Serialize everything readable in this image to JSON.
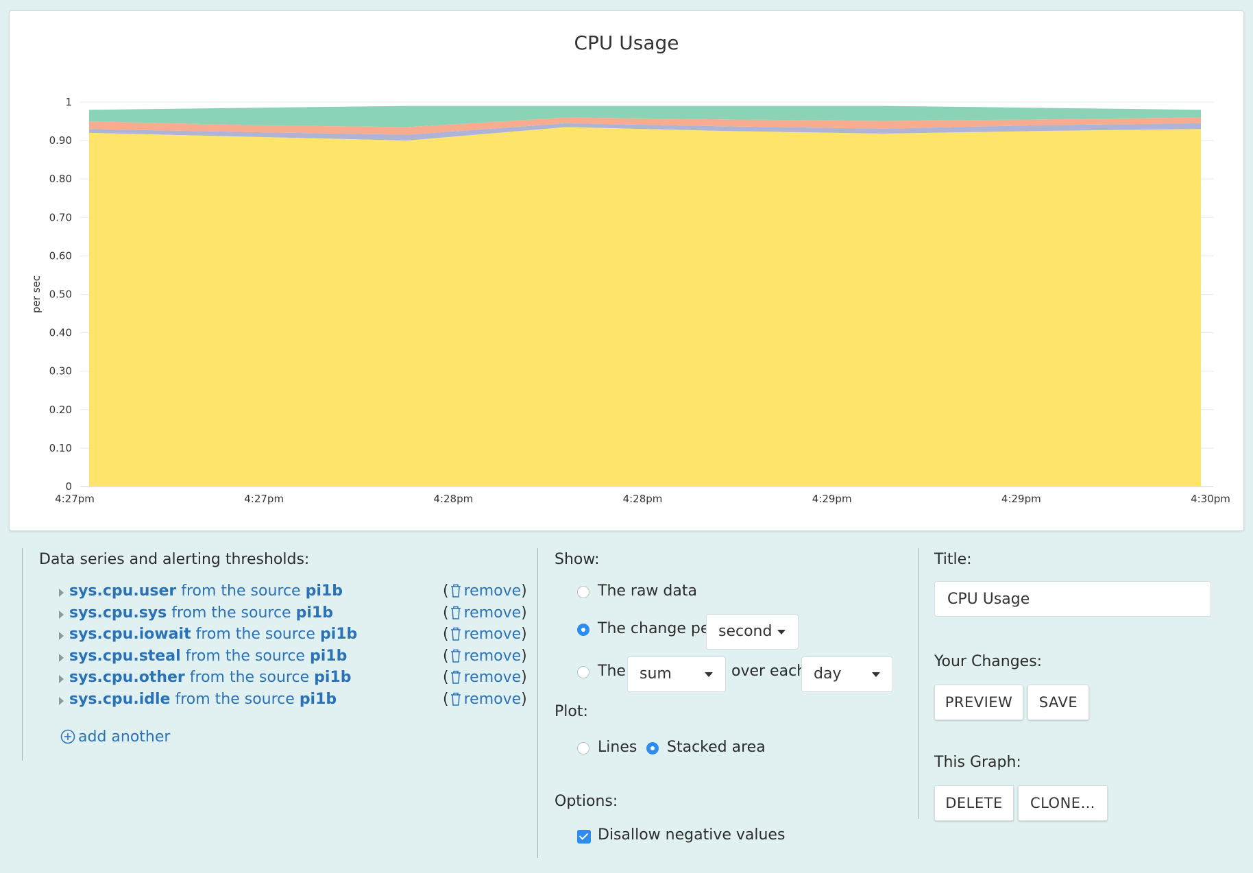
{
  "chart": {
    "title": "CPU Usage"
  },
  "chart_data": {
    "type": "area",
    "stacked": true,
    "title": "CPU Usage",
    "ylabel": "per sec",
    "xlabel": "",
    "ylim": [
      0,
      1
    ],
    "y_ticks": [
      "0",
      "0.10",
      "0.20",
      "0.30",
      "0.40",
      "0.50",
      "0.60",
      "0.70",
      "0.80",
      "0.90",
      "1"
    ],
    "x_tick_labels": [
      "4:27pm",
      "4:27pm",
      "4:28pm",
      "4:28pm",
      "4:29pm",
      "4:29pm",
      "4:30pm"
    ],
    "grid": true,
    "legend": "none",
    "series": [
      {
        "color": "#ffe363",
        "values": [
          0.92,
          0.91,
          0.9,
          0.935,
          0.925,
          0.918,
          0.925,
          0.93
        ]
      },
      {
        "color": "#a9b0d6",
        "values": [
          0.01,
          0.012,
          0.015,
          0.01,
          0.012,
          0.013,
          0.015,
          0.015
        ]
      },
      {
        "color": "#f8a889",
        "values": [
          0.02,
          0.018,
          0.02,
          0.015,
          0.018,
          0.02,
          0.015,
          0.015
        ]
      },
      {
        "color": "#85d1b2",
        "values": [
          0.03,
          0.045,
          0.055,
          0.03,
          0.035,
          0.039,
          0.03,
          0.02
        ]
      }
    ]
  },
  "series_panel": {
    "heading": "Data series and alerting thresholds:",
    "from_text": "from the source",
    "remove_label": "remove",
    "items": [
      {
        "metric": "sys.cpu.user",
        "source": "pi1b"
      },
      {
        "metric": "sys.cpu.sys",
        "source": "pi1b"
      },
      {
        "metric": "sys.cpu.iowait",
        "source": "pi1b"
      },
      {
        "metric": "sys.cpu.steal",
        "source": "pi1b"
      },
      {
        "metric": "sys.cpu.other",
        "source": "pi1b"
      },
      {
        "metric": "sys.cpu.idle",
        "source": "pi1b"
      }
    ],
    "add_another": "add another"
  },
  "show_panel": {
    "heading": "Show:",
    "raw_data": "The raw data",
    "change_per": "The change per",
    "change_unit": "second",
    "the": "The",
    "aggregate": "sum",
    "over_each": "over each",
    "period": "day",
    "plot_heading": "Plot:",
    "lines": "Lines",
    "stacked_area": "Stacked area",
    "options_heading": "Options:",
    "disallow_negative": "Disallow negative values"
  },
  "settings_panel": {
    "title_heading": "Title:",
    "title_value": "CPU Usage",
    "changes_heading": "Your Changes:",
    "preview": "PREVIEW",
    "save": "SAVE",
    "graph_heading": "This Graph:",
    "delete": "DELETE",
    "clone": "CLONE…"
  }
}
